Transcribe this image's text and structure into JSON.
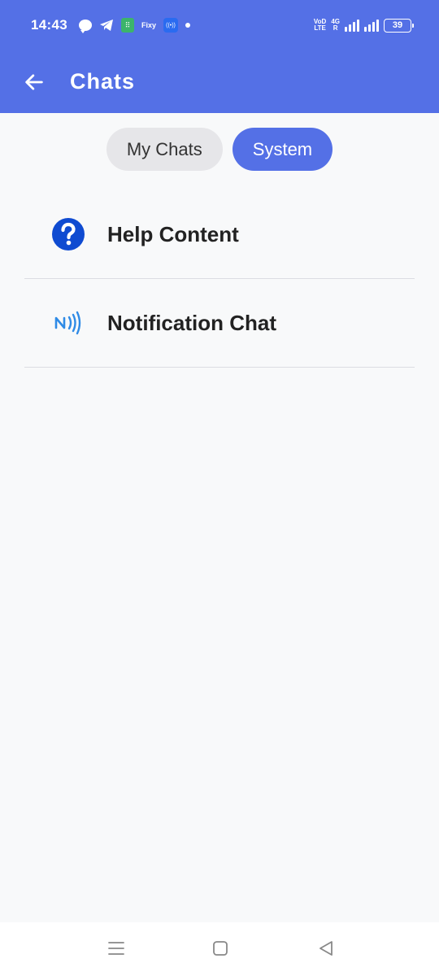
{
  "status_bar": {
    "time": "14:43",
    "fixy_label": "Fixy",
    "green_app_glyph": "⠿",
    "radio_glyph": "((•))",
    "network_label_top": "VoD",
    "network_label_bottom": "LTE",
    "network_type": "4G",
    "roaming": "R",
    "battery_level": "39",
    "icons": [
      "chat-bubble-icon",
      "telegram-icon",
      "green-app-icon",
      "fixy-icon",
      "radio-icon",
      "dot-icon",
      "signal-icon",
      "battery-icon"
    ]
  },
  "app_bar": {
    "title": "Chats",
    "back_icon": "arrow-left-icon",
    "background": "#5470e6"
  },
  "tabs": [
    {
      "label": "My Chats",
      "active": false
    },
    {
      "label": "System",
      "active": true
    }
  ],
  "list": {
    "items": [
      {
        "label": "Help Content",
        "icon": "help-circle-icon",
        "icon_color": "#0f4bd1"
      },
      {
        "label": "Notification Chat",
        "icon": "notification-nfc-icon",
        "icon_color": "#2f8be6"
      }
    ]
  },
  "nav_bar": {
    "icons": [
      "menu-icon",
      "home-square-icon",
      "back-triangle-icon"
    ]
  }
}
